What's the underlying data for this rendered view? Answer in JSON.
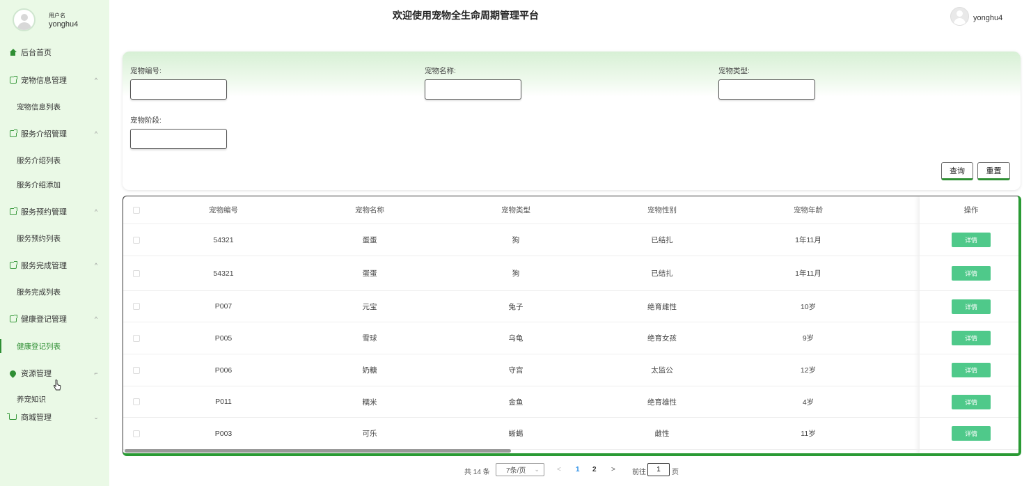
{
  "sidebar": {
    "user_caption": "用户名",
    "user_name": "yonghu4",
    "menu": [
      {
        "label": "后台首页",
        "icon": "home-icon"
      },
      {
        "label": "宠物信息管理",
        "icon": "doc-icon",
        "arrow": "^",
        "children": [
          "宠物信息列表"
        ]
      },
      {
        "label": "服务介绍管理",
        "icon": "doc-icon",
        "arrow": "^",
        "children": [
          "服务介绍列表",
          "服务介绍添加"
        ]
      },
      {
        "label": "服务预约管理",
        "icon": "doc-icon",
        "arrow": "^",
        "children": [
          "服务预约列表"
        ]
      },
      {
        "label": "服务完成管理",
        "icon": "doc-icon",
        "arrow": "^",
        "children": [
          "服务完成列表"
        ]
      },
      {
        "label": "健康登记管理",
        "icon": "doc-icon",
        "arrow": "^",
        "children": [
          "健康登记列表"
        ]
      },
      {
        "label": "资源管理",
        "icon": "pin-icon",
        "arrow": "⌐",
        "children": [
          "养宠知识"
        ]
      },
      {
        "label": "商城管理",
        "icon": "cart-icon",
        "arrow": "⌄"
      }
    ],
    "active_item": "健康登记列表"
  },
  "header": {
    "title": "欢迎使用宠物全生命周期管理平台",
    "user_name": "yonghu4"
  },
  "search": {
    "fields": [
      {
        "label": "宠物编号:",
        "value": ""
      },
      {
        "label": "宠物名称:",
        "value": ""
      },
      {
        "label": "宠物类型:",
        "value": ""
      },
      {
        "label": "宠物阶段:",
        "value": ""
      }
    ],
    "query_label": "查询",
    "reset_label": "重置"
  },
  "table": {
    "columns": [
      "宠物编号",
      "宠物名称",
      "宠物类型",
      "宠物性别",
      "宠物年龄",
      "操作"
    ],
    "detail_label": "详情",
    "rows": [
      [
        "54321",
        "蛋蛋",
        "狗",
        "已结扎",
        "1年11月"
      ],
      [
        "54321",
        "蛋蛋",
        "狗",
        "已结扎",
        "1年11月"
      ],
      [
        "P007",
        "元宝",
        "兔子",
        "绝育雌性",
        "10岁"
      ],
      [
        "P005",
        "雪球",
        "乌龟",
        "绝育女孩",
        "9岁"
      ],
      [
        "P006",
        "奶糖",
        "守宫",
        "太监公",
        "12岁"
      ],
      [
        "P011",
        "糯米",
        "金鱼",
        "绝育雄性",
        "4岁"
      ],
      [
        "P003",
        "可乐",
        "蜥蜴",
        "雌性",
        "11岁"
      ]
    ]
  },
  "pagination": {
    "total_text": "共 14 条",
    "page_size": "7条/页",
    "pages": [
      "1",
      "2"
    ],
    "current_page": "1",
    "prev": "<",
    "next": ">",
    "goto_label": "前往",
    "goto_value": "1",
    "page_unit": "页"
  },
  "colors": {
    "sidebar_bg": "#eaf9e6",
    "accent_green": "#2f8f34",
    "detail_button": "#4fc98a",
    "page_active": "#1e88e5"
  }
}
